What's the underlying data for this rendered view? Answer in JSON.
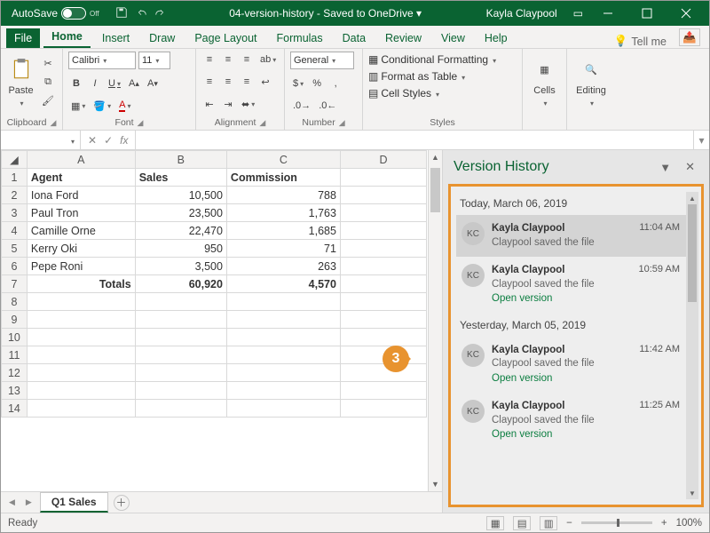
{
  "titlebar": {
    "autosave_label": "AutoSave",
    "autosave_state": "Off",
    "doc_title": "04-version-history - Saved to OneDrive ▾",
    "user": "Kayla Claypool"
  },
  "tabs": {
    "file": "File",
    "items": [
      "Home",
      "Insert",
      "Draw",
      "Page Layout",
      "Formulas",
      "Data",
      "Review",
      "View",
      "Help"
    ],
    "active": "Home",
    "tellme": "Tell me"
  },
  "ribbon": {
    "clipboard": {
      "label": "Clipboard",
      "paste": "Paste"
    },
    "font": {
      "label": "Font",
      "name": "Calibri",
      "size": "11"
    },
    "alignment": {
      "label": "Alignment"
    },
    "number": {
      "label": "Number",
      "format": "General"
    },
    "styles": {
      "label": "Styles",
      "cond": "Conditional Formatting",
      "table": "Format as Table",
      "cell": "Cell Styles"
    },
    "cells": {
      "label": "Cells"
    },
    "editing": {
      "label": "Editing"
    }
  },
  "fxbar": {
    "namebox": "",
    "fx": "fx"
  },
  "sheet": {
    "columns": [
      "A",
      "B",
      "C",
      "D"
    ],
    "rows": [
      "1",
      "2",
      "3",
      "4",
      "5",
      "6",
      "7",
      "8",
      "9",
      "10",
      "11",
      "12",
      "13",
      "14"
    ],
    "header": [
      "Agent",
      "Sales",
      "Commission",
      ""
    ],
    "data": [
      [
        "Iona Ford",
        "10,500",
        "788",
        ""
      ],
      [
        "Paul Tron",
        "23,500",
        "1,763",
        ""
      ],
      [
        "Camille Orne",
        "22,470",
        "1,685",
        ""
      ],
      [
        "Kerry Oki",
        "950",
        "71",
        ""
      ],
      [
        "Pepe Roni",
        "3,500",
        "263",
        ""
      ]
    ],
    "totals": [
      "Totals",
      "60,920",
      "4,570",
      ""
    ],
    "tab": "Q1 Sales"
  },
  "pane": {
    "title": "Version History",
    "groups": [
      {
        "label": "Today, March 06, 2019",
        "items": [
          {
            "initials": "KC",
            "name": "Kayla Claypool",
            "desc": "Claypool saved the file",
            "time": "11:04 AM",
            "selected": true,
            "open": false
          },
          {
            "initials": "KC",
            "name": "Kayla Claypool",
            "desc": "Claypool saved the file",
            "time": "10:59 AM",
            "selected": false,
            "open": true
          }
        ]
      },
      {
        "label": "Yesterday, March 05, 2019",
        "items": [
          {
            "initials": "KC",
            "name": "Kayla Claypool",
            "desc": "Claypool saved the file",
            "time": "11:42 AM",
            "selected": false,
            "open": true
          },
          {
            "initials": "KC",
            "name": "Kayla Claypool",
            "desc": "Claypool saved the file",
            "time": "11:25 AM",
            "selected": false,
            "open": true
          }
        ]
      }
    ],
    "open_label": "Open version"
  },
  "status": {
    "ready": "Ready",
    "zoom": "100%"
  },
  "callout": "3"
}
